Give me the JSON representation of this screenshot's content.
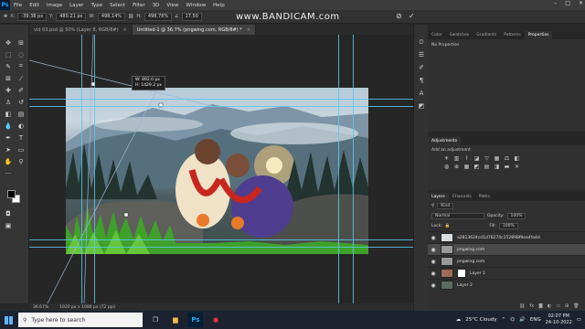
{
  "menu": {
    "items": [
      "File",
      "Edit",
      "Image",
      "Layer",
      "Type",
      "Select",
      "Filter",
      "3D",
      "View",
      "Window",
      "Help"
    ]
  },
  "options": {
    "x_label": "X:",
    "x_value": "-39.38 px",
    "y_label": "Y:",
    "y_value": "480.21 px",
    "w_label": "W:",
    "w_value": "498.14%",
    "h_label": "H:",
    "h_value": "498.76%",
    "angle_value": "17.50",
    "interp": "Bicubic"
  },
  "watermark": "www.BANDICAM.com",
  "tabs": [
    {
      "label": "vid 03.psd @ 50% (Layer 8, RGB/8#)"
    },
    {
      "label": "Untitled-1 @ 36.7% (pngwing.com, RGB/8#) *"
    }
  ],
  "tooltip": {
    "w": "W:    892.0 px",
    "h": "H:    1429.2 px"
  },
  "status": {
    "zoom": "36.67%",
    "size": "1920 px x 1080 px (72 ppi)"
  },
  "props_panel": {
    "tabs": [
      "Color",
      "Swatches",
      "Gradients",
      "Patterns",
      "Properties"
    ],
    "no_props": "No Properties"
  },
  "adjustments": {
    "title": "Adjustments",
    "add": "Add an adjustment"
  },
  "layers_panel": {
    "tabs": [
      "Layers",
      "Channels",
      "Paths"
    ],
    "kind": "Kind",
    "blend": "Normal",
    "opacity_label": "Opacity:",
    "opacity_value": "100%",
    "lock_label": "Lock:",
    "fill_label": "Fill:",
    "fill_value": "100%",
    "rows": [
      {
        "name": "a2813624cd1d78274c152898f9ea4fa4d",
        "selected": false
      },
      {
        "name": "pngwing.com",
        "selected": true
      },
      {
        "name": "pngwing.com",
        "selected": false
      },
      {
        "name": "Layer 1",
        "selected": false
      },
      {
        "name": "Layer 2",
        "selected": false
      }
    ]
  },
  "taskbar": {
    "search_placeholder": "Type here to search",
    "weather": "25°C  Cloudy",
    "lang": "ENG",
    "time": "02:07 PM",
    "date": "24-10-2022"
  },
  "colors": {
    "accent": "#31a8ff",
    "guide": "#5ac8eb",
    "canvas_bg": "#262626"
  }
}
